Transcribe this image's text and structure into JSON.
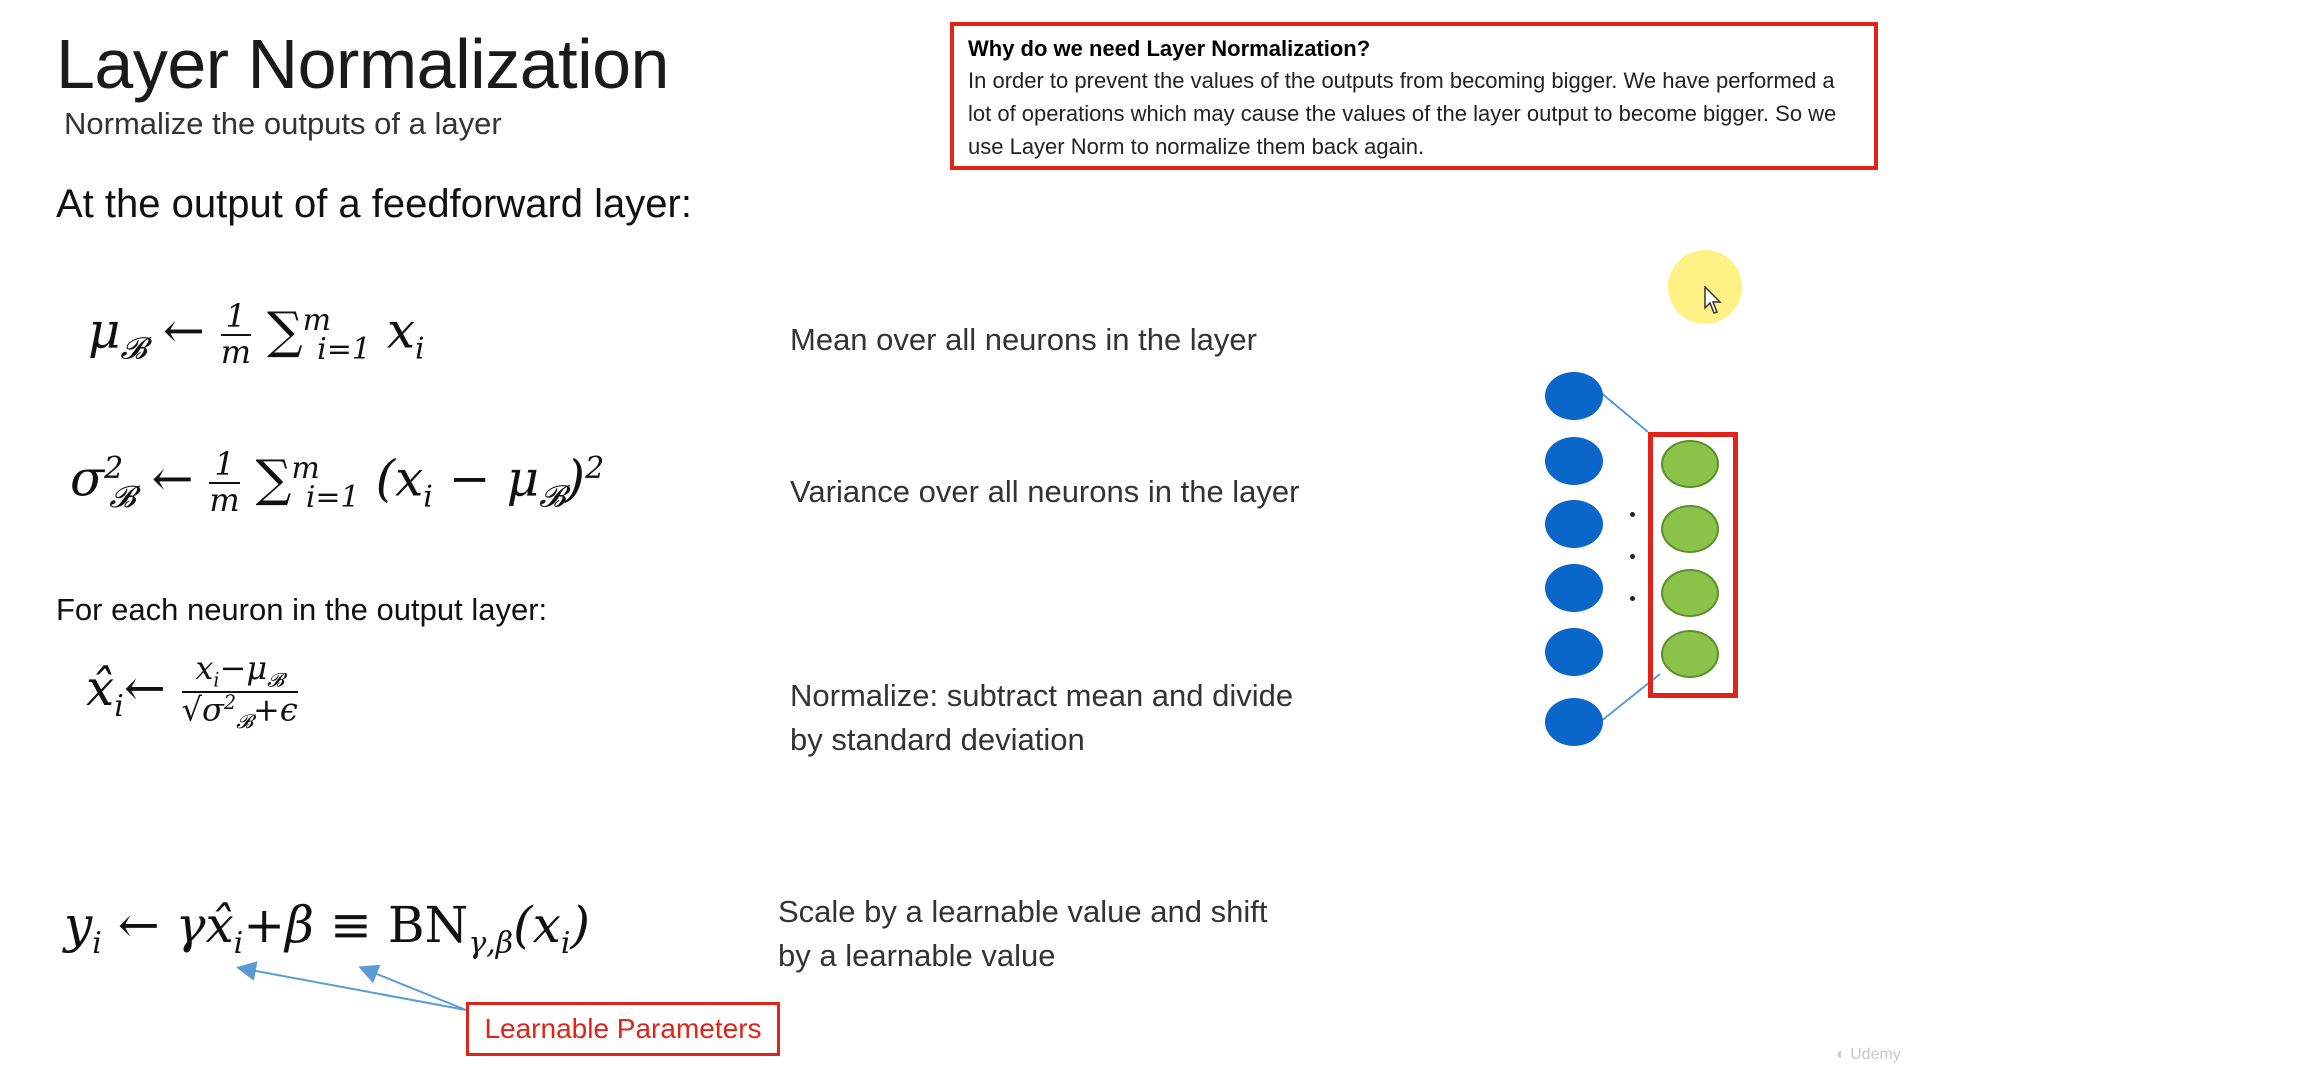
{
  "slide": {
    "title": "Layer Normalization",
    "subtitle": "Normalize the outputs of a layer",
    "section_heading": "At the output of a feedforward layer:",
    "subheading": "For each neuron in the output layer:"
  },
  "callout": {
    "title": "Why do we need Layer Normalization?",
    "body": "In order to prevent the values of the outputs from becoming bigger. We have performed a lot of operations which may cause the values of the layer output to become bigger. So we use Layer Norm to normalize them back again."
  },
  "descriptions": {
    "mean": "Mean over all neurons in the layer",
    "variance": "Variance over all neurons in the layer",
    "normalize_line1": "Normalize: subtract mean and divide",
    "normalize_line2": "by standard deviation",
    "scale_line1": "Scale by a learnable value and shift",
    "scale_line2": "by a learnable value"
  },
  "labels": {
    "learnable_parameters": "Learnable Parameters"
  },
  "formulas": {
    "mu_lhs": "μ",
    "mu_sub": "𝓑",
    "arrow": "←",
    "one": "1",
    "m": "m",
    "sum": "∑",
    "sum_sup": "m",
    "sum_sub": "i=1",
    "xi": "x",
    "i": "i",
    "sigma": "σ",
    "sq": "2",
    "var_body": "(x",
    "minus_mu": " − μ",
    "close_sq": ")",
    "xhat": "x̂",
    "num": "x",
    "num_rest": "−μ",
    "den": "√σ",
    "den_rest": "+ϵ",
    "y": "y",
    "gamma_xhat": "γx̂",
    "plus_beta": "+β",
    "equiv": "≡",
    "bn": "BN",
    "bn_sub": "γ,β",
    "bn_arg": "(x",
    "close": ")"
  },
  "colors": {
    "accent_red": "#e0241a",
    "neuron_blue": "#0a66c8",
    "neuron_green": "#8bc34a",
    "arrow_blue": "#5b9bd5"
  }
}
